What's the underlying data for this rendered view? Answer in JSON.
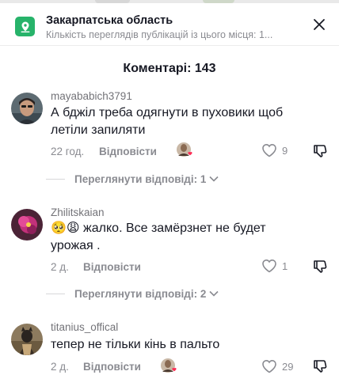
{
  "location": {
    "title": "Закарпатська область",
    "subtitle": "Кількість переглядів публікацій із цього місця: 1...",
    "icon": "location-pin-icon",
    "accent": "#27b36a"
  },
  "comments_header": "Коментарі: 143",
  "comments": [
    {
      "username": "mayababich3791",
      "text": "А бджіл треба одягнути в пуховики щоб летіли запиляти",
      "time": "22 год.",
      "reply_label": "Відповісти",
      "likes": "9",
      "creator_liked": true,
      "view_replies": "Переглянути відповіді: 1"
    },
    {
      "username": "Zhilitskaian",
      "text": "🥺😩 жалко. Все замёрзнет не будет урожая .",
      "time": "2 д.",
      "reply_label": "Відповісти",
      "likes": "1",
      "creator_liked": false,
      "view_replies": "Переглянути відповіді: 2"
    },
    {
      "username": "titanius_offical",
      "text": "тепер не тільки кінь в пальто",
      "time": "2 д.",
      "reply_label": "Відповісти",
      "likes": "29",
      "creator_liked": true
    }
  ],
  "colors": {
    "text": "#161823",
    "secondary": "#8a8b91",
    "like_heart": "#fe2c55"
  }
}
